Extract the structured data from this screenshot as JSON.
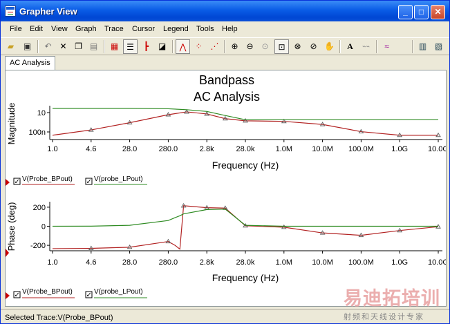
{
  "window": {
    "title": "Grapher View"
  },
  "menu": [
    "File",
    "Edit",
    "View",
    "Graph",
    "Trace",
    "Cursor",
    "Legend",
    "Tools",
    "Help"
  ],
  "toolbar_icons": [
    "open-icon",
    "save-icon",
    "undo-icon",
    "delete-icon",
    "copy-icon",
    "paste-icon",
    "grid-icon",
    "legend-icon",
    "axis-icon",
    "reverse-colors-icon",
    "show-cursors-icon",
    "show-points-icon",
    "select-marks-icon",
    "zoom-in-icon",
    "zoom-out-icon",
    "zoom-fit-icon",
    "zoom-area-icon",
    "zoom-x-icon",
    "zoom-y-icon",
    "pan-hand-icon",
    "text-icon",
    "export-icon",
    "overlay-icon",
    "print-icon",
    "print-preview-icon"
  ],
  "tab": {
    "label": "AC Analysis"
  },
  "graph": {
    "title_line1": "Bandpass",
    "title_line2": "AC Analysis",
    "x_tick_labels": [
      "1.0",
      "4.6",
      "28.0",
      "280.0",
      "2.8k",
      "28.0k",
      "1.0M",
      "10.0M",
      "100.0M",
      "1.0G",
      "10.0G"
    ],
    "legend1": "V(Probe_BPout)",
    "legend2": "V(probe_LPout)"
  },
  "chart_data": [
    {
      "type": "line",
      "title": "Bandpass AC Analysis",
      "xlabel": "Frequency (Hz)",
      "ylabel": "Magnitude",
      "x_scale": "log",
      "y_scale": "log",
      "xlim": [
        1,
        10000000000
      ],
      "y_tick_labels": [
        "10",
        "100n"
      ],
      "x_tick_labels": [
        "1.0",
        "4.6",
        "28.0",
        "280.0",
        "2.8k",
        "28.0k",
        "1.0M",
        "10.0M",
        "100.0M",
        "1.0G",
        "10.0G"
      ],
      "x": [
        1,
        10,
        100,
        1000,
        3000,
        10000,
        30000,
        100000,
        1000000,
        10000000,
        100000000,
        1000000000,
        10000000000
      ],
      "series": [
        {
          "name": "V(Probe_BPout)",
          "color": "#B22222",
          "values": [
            1e-06,
            3e-05,
            0.003,
            0.5,
            3,
            0.8,
            0.04,
            0.01,
            0.007,
            0.001,
            1e-05,
            1e-06,
            1e-06
          ]
        },
        {
          "name": "V(probe_LPout)",
          "color": "#2E8B22",
          "values": [
            30,
            30,
            30,
            22,
            12,
            4,
            0.3,
            0.02,
            0.02,
            0.02,
            0.02,
            0.02,
            0.02
          ]
        }
      ],
      "legend": "bottom-left"
    },
    {
      "type": "line",
      "xlabel": "Frequency (Hz)",
      "ylabel": "Phase (deg)",
      "x_scale": "log",
      "xlim": [
        1,
        10000000000
      ],
      "ylim": [
        -250,
        250
      ],
      "y_tick_labels": [
        "200",
        "0",
        "-200"
      ],
      "x_tick_labels": [
        "1.0",
        "4.6",
        "28.0",
        "280.0",
        "2.8k",
        "28.0k",
        "1.0M",
        "10.0M",
        "100.0M",
        "1.0G",
        "10.0G"
      ],
      "x": [
        1,
        10,
        100,
        1000,
        1500,
        2000,
        2500,
        10000,
        30000,
        100000,
        1000000,
        10000000,
        100000000,
        1000000000,
        10000000000
      ],
      "series": [
        {
          "name": "V(Probe_BPout)",
          "color": "#B22222",
          "values": [
            -235,
            -232,
            -220,
            -160,
            -200,
            -240,
            215,
            195,
            190,
            5,
            -10,
            -70,
            -95,
            -45,
            -5
          ]
        },
        {
          "name": "V(probe_LPout)",
          "color": "#2E8B22",
          "values": [
            0,
            1,
            10,
            60,
            90,
            110,
            130,
            175,
            180,
            10,
            0,
            0,
            0,
            0,
            0
          ]
        }
      ],
      "legend": "bottom-left"
    }
  ],
  "status": {
    "text": "Selected Trace:V(Probe_BPout)"
  },
  "watermark": {
    "main": "易迪拓培训",
    "sub": "射频和天线设计专家"
  }
}
